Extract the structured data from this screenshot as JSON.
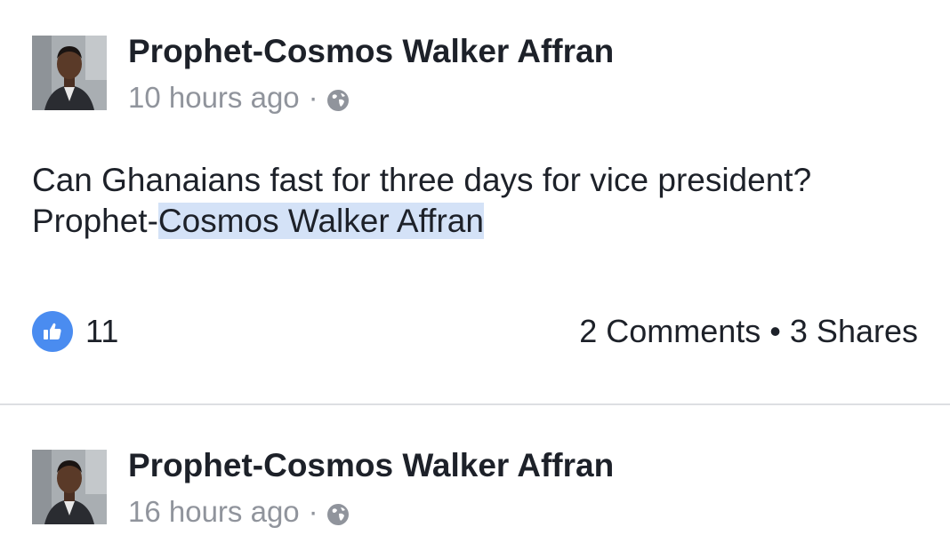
{
  "posts": [
    {
      "author": "Prophet-Cosmos Walker Affran",
      "time": "10 hours ago",
      "separator": "·",
      "privacy_icon": "globe-icon",
      "text_line1": "Can Ghanaians fast for three days for vice president?",
      "text_line2_prefix": "Prophet-",
      "text_line2_highlighted": "Cosmos Walker Affran",
      "likes": "11",
      "comments": "2 Comments",
      "bullet": "•",
      "shares": "3 Shares"
    },
    {
      "author": "Prophet-Cosmos Walker Affran",
      "time": "16 hours ago",
      "separator": "·",
      "privacy_icon": "globe-icon"
    }
  ],
  "colors": {
    "like_badge": "#4a8cf0",
    "highlight": "#d4e2f7",
    "meta_text": "#90949c",
    "divider": "#dddfe2"
  }
}
